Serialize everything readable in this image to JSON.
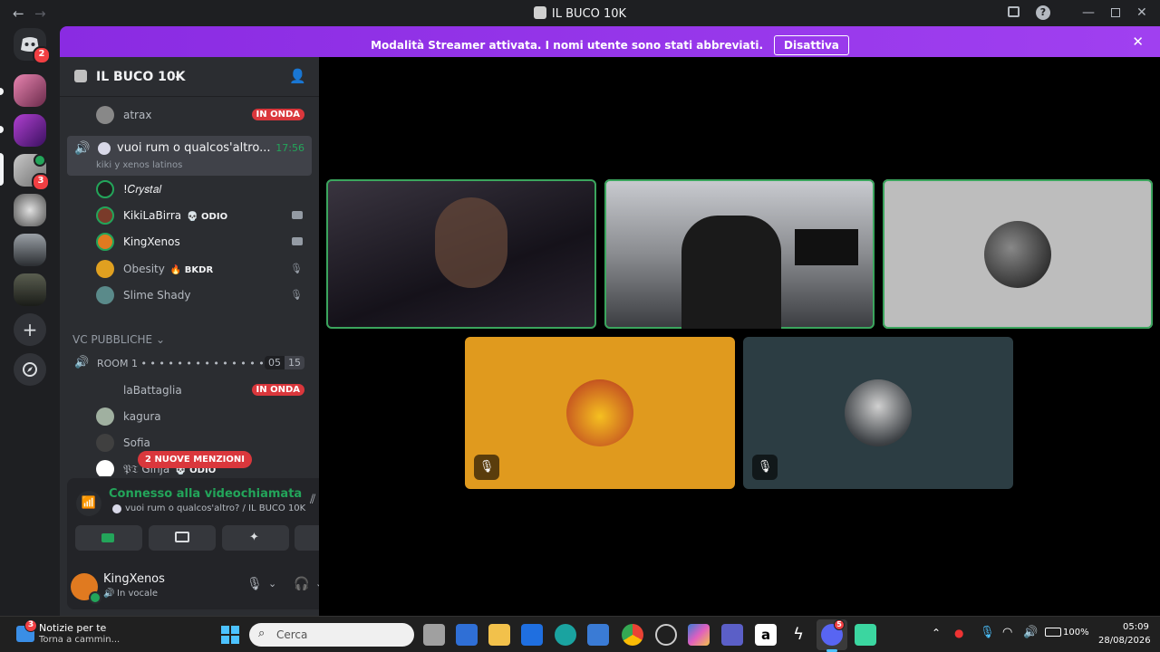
{
  "window": {
    "title": "IL BUCO 10K"
  },
  "rail": {
    "home_badge": "2",
    "server_badge": "3"
  },
  "banner": {
    "message": "Modalità Streamer attivata. I nomi utente sono stati abbreviati.",
    "button": "Disattiva"
  },
  "sidebar": {
    "server_name": "IL BUCO 10K",
    "members_top": [
      {
        "name": "atrax",
        "status": "IN ONDA"
      }
    ],
    "active_channel": {
      "name": "vuoi rum o qualcos'altro...",
      "time": "17:56",
      "subtitle": "kiki y xenos latinos"
    },
    "members": [
      {
        "name": "!𝐶𝑟𝑦𝑠𝑡𝑎𝑙",
        "tag": "",
        "indicator": "none"
      },
      {
        "name": "KikiLaBirra",
        "tag": "💀 ODIO",
        "indicator": "camera"
      },
      {
        "name": "KingXenos",
        "tag": "",
        "indicator": "camera"
      },
      {
        "name": "Obesity",
        "tag": "🔥 BKDR",
        "indicator": "muted"
      },
      {
        "name": "Slime Shady",
        "tag": "",
        "indicator": "muted"
      }
    ],
    "category": "VC PUBBLICHE",
    "room": {
      "name": "ROOM 1 • • • • • • • • • • • • • • •",
      "count_a": "05",
      "count_b": "15"
    },
    "room_members": [
      {
        "name": "laBattaglia",
        "status": "IN ONDA"
      },
      {
        "name": "kagura",
        "status": ""
      },
      {
        "name": "Sofia",
        "status": ""
      },
      {
        "name": "𝔓𝔗 Ginja",
        "tag": "💀 ODIO"
      }
    ],
    "mentions_pill": "2 NUOVE MENZIONI"
  },
  "voice": {
    "status": "Connesso alla videochiamata",
    "channel": "vuoi rum o qualcos'altro? / IL BUCO 10K"
  },
  "user": {
    "name": "KingXenos",
    "status": "In vocale"
  },
  "taskbar": {
    "news_title": "Notizie per te",
    "news_sub": "Torna a cammin...",
    "news_badge": "3",
    "search_placeholder": "Cerca",
    "discord_badge": "5",
    "battery": "100%",
    "time": "05:09",
    "date": "28/08/2026"
  },
  "colors": {
    "accent_purple": "#9b30ff",
    "speaking_green": "#3ba55d",
    "live_red": "#da373c",
    "tile_orange": "#e09a1e",
    "tile_slate": "#2c3d43"
  }
}
